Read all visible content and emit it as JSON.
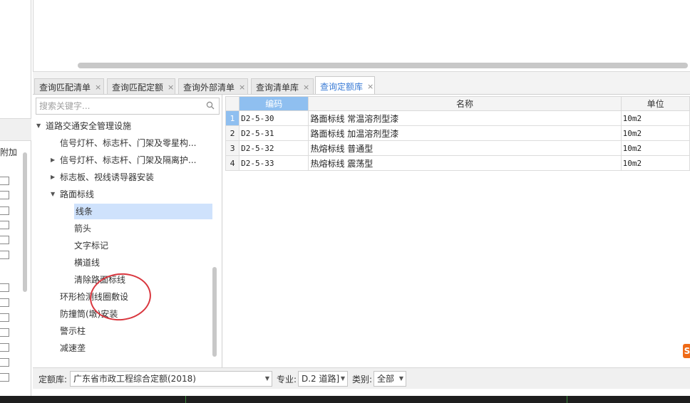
{
  "left_panel": {
    "header": "附加",
    "checkbox_count": 13
  },
  "tabs": [
    {
      "label": "查询匹配清单",
      "close": "×",
      "active": false
    },
    {
      "label": "查询匹配定额",
      "close": "×",
      "active": false
    },
    {
      "label": "查询外部清单",
      "close": "×",
      "active": false
    },
    {
      "label": "查询清单库",
      "close": "×",
      "active": false
    },
    {
      "label": "查询定额库",
      "close": "×",
      "active": true
    }
  ],
  "search": {
    "placeholder": "搜索关键字...",
    "value": ""
  },
  "tree": [
    {
      "label": "道路交通安全管理设施",
      "level": 0,
      "expander": "▼"
    },
    {
      "label": "信号灯杆、标志杆、门架及零星构...",
      "level": 1,
      "expander": ""
    },
    {
      "label": "信号灯杆、标志杆、门架及隔离护...",
      "level": 1,
      "expander": "▶"
    },
    {
      "label": "标志板、视线诱导器安装",
      "level": 1,
      "expander": "▶"
    },
    {
      "label": "路面标线",
      "level": 1,
      "expander": "▼"
    },
    {
      "label": "线条",
      "level": 2,
      "expander": "",
      "selected": true
    },
    {
      "label": "箭头",
      "level": 2,
      "expander": ""
    },
    {
      "label": "文字标记",
      "level": 2,
      "expander": ""
    },
    {
      "label": "横道线",
      "level": 2,
      "expander": ""
    },
    {
      "label": "清除路面标线",
      "level": 2,
      "expander": ""
    },
    {
      "label": "环形检测线圈敷设",
      "level": 1,
      "expander": ""
    },
    {
      "label": "防撞筒(墩)安装",
      "level": 1,
      "expander": ""
    },
    {
      "label": "警示柱",
      "level": 1,
      "expander": ""
    },
    {
      "label": "减速垄",
      "level": 1,
      "expander": ""
    }
  ],
  "grid": {
    "columns": [
      "编码",
      "名称",
      "单位"
    ],
    "rows": [
      {
        "num": "1",
        "code": "D2-5-30",
        "name": "路面标线 常温溶剂型漆",
        "unit": "10m2"
      },
      {
        "num": "2",
        "code": "D2-5-31",
        "name": "路面标线 加温溶剂型漆",
        "unit": "10m2"
      },
      {
        "num": "3",
        "code": "D2-5-32",
        "name": "热熔标线 普通型",
        "unit": "10m2"
      },
      {
        "num": "4",
        "code": "D2-5-33",
        "name": "热熔标线 震荡型",
        "unit": "10m2"
      }
    ]
  },
  "bottom": {
    "quota_label": "定额库:",
    "quota_value": "广东省市政工程综合定额(2018)",
    "major_label": "专业:",
    "major_value": "D.2 道路]",
    "category_label": "类别:",
    "category_value": "全部"
  },
  "side_badge": "S",
  "colors": {
    "accent": "#3a7bd5",
    "selected_bg": "#cfe2fc",
    "header_selected": "#8fbff0",
    "annotation": "#d9363e",
    "badge": "#ef6a16"
  }
}
